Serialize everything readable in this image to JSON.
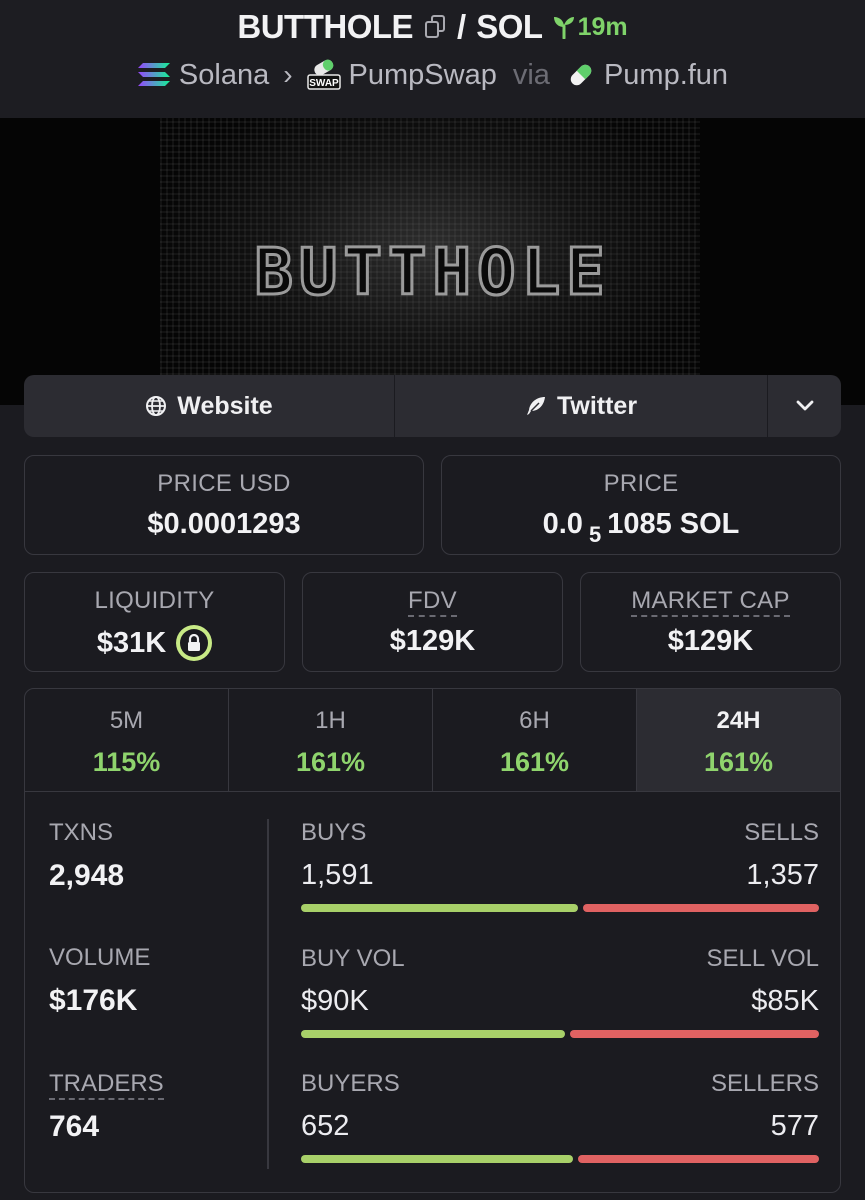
{
  "header": {
    "token": "BUTTHOLE",
    "separator": "/",
    "quote": "SOL",
    "age": "19m",
    "chain": "Solana",
    "dex": "PumpSwap",
    "dex_badge": "SWAP",
    "via": "via",
    "launchpad": "Pump.fun"
  },
  "banner": {
    "title": "BUTTHOLE"
  },
  "links": {
    "website": "Website",
    "twitter": "Twitter"
  },
  "price_usd": {
    "label": "PRICE USD",
    "value": "$0.0001293"
  },
  "price": {
    "label": "PRICE",
    "prefix": "0.0",
    "zeros": "5",
    "digits": "1085 SOL"
  },
  "liquidity": {
    "label": "LIQUIDITY",
    "value": "$31K"
  },
  "fdv": {
    "label": "FDV",
    "value": "$129K"
  },
  "market_cap": {
    "label": "MARKET CAP",
    "value": "$129K"
  },
  "timeframes": [
    {
      "label": "5M",
      "change": "115%"
    },
    {
      "label": "1H",
      "change": "161%"
    },
    {
      "label": "6H",
      "change": "161%"
    },
    {
      "label": "24H",
      "change": "161%",
      "active": true
    }
  ],
  "stats": {
    "txns_label": "TXNS",
    "txns": "2,948",
    "volume_label": "VOLUME",
    "volume": "$176K",
    "traders_label": "TRADERS",
    "traders": "764"
  },
  "buys_sells": {
    "left_label": "BUYS",
    "right_label": "SELLS",
    "left": "1,591",
    "right": "1,357",
    "left_fraction": 0.54
  },
  "volumes": {
    "left_label": "BUY VOL",
    "right_label": "SELL VOL",
    "left": "$90K",
    "right": "$85K",
    "left_fraction": 0.515
  },
  "buyers_sellers": {
    "left_label": "BUYERS",
    "right_label": "SELLERS",
    "left": "652",
    "right": "577",
    "left_fraction": 0.53
  },
  "colors": {
    "green": "#8fd46d",
    "red": "#e06262",
    "background": "#1b1b20"
  }
}
